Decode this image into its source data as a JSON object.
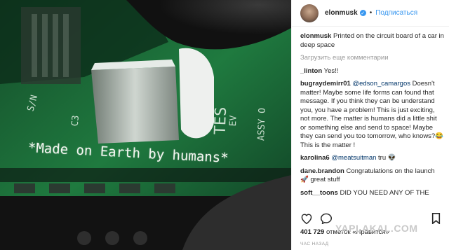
{
  "post": {
    "username": "elonmusk",
    "follow_label": "Подписаться",
    "caption": "Printed on the circuit board of a car in deep space",
    "load_more": "Загрузить еще комментарии",
    "likes_count": "401 729",
    "likes_label": "отметок «Нравится»",
    "time_label": "ЧАС НАЗАД"
  },
  "comments": [
    {
      "user": "_linton",
      "mention": "",
      "text": "Yes!!"
    },
    {
      "user": "bugraydemirr01",
      "mention": "@edson_camargos",
      "text": "Doesn't matter! Maybe some life forms can found that message. If you think they can be understand you, you have a problem! This is just exciting, not more. The matter is humans did a little shit or something else and send to space! Maybe they can send you too tomorrow, who knows?😂 This is the matter !"
    },
    {
      "user": "karolina6",
      "mention": "@meatsuitman",
      "text": "tru 👽"
    },
    {
      "user": "dane.brandon",
      "mention": "",
      "text": "Congratulations on the launch 🚀 great stuff"
    },
    {
      "user": "soft__toons",
      "mention": "",
      "text": "DID YOU NEED ANY OF THE"
    }
  ],
  "photo": {
    "board_text": "*Made on Earth by humans*",
    "silk_test": "TES",
    "silk_c3": "C3",
    "silk_sn": "S/N",
    "silk_ev": "EV",
    "silk_assy": "ASSY O"
  },
  "watermark": "YAPLAKAL.COM",
  "colors": {
    "accent": "#3897f0",
    "board": "#1f7a3f"
  }
}
